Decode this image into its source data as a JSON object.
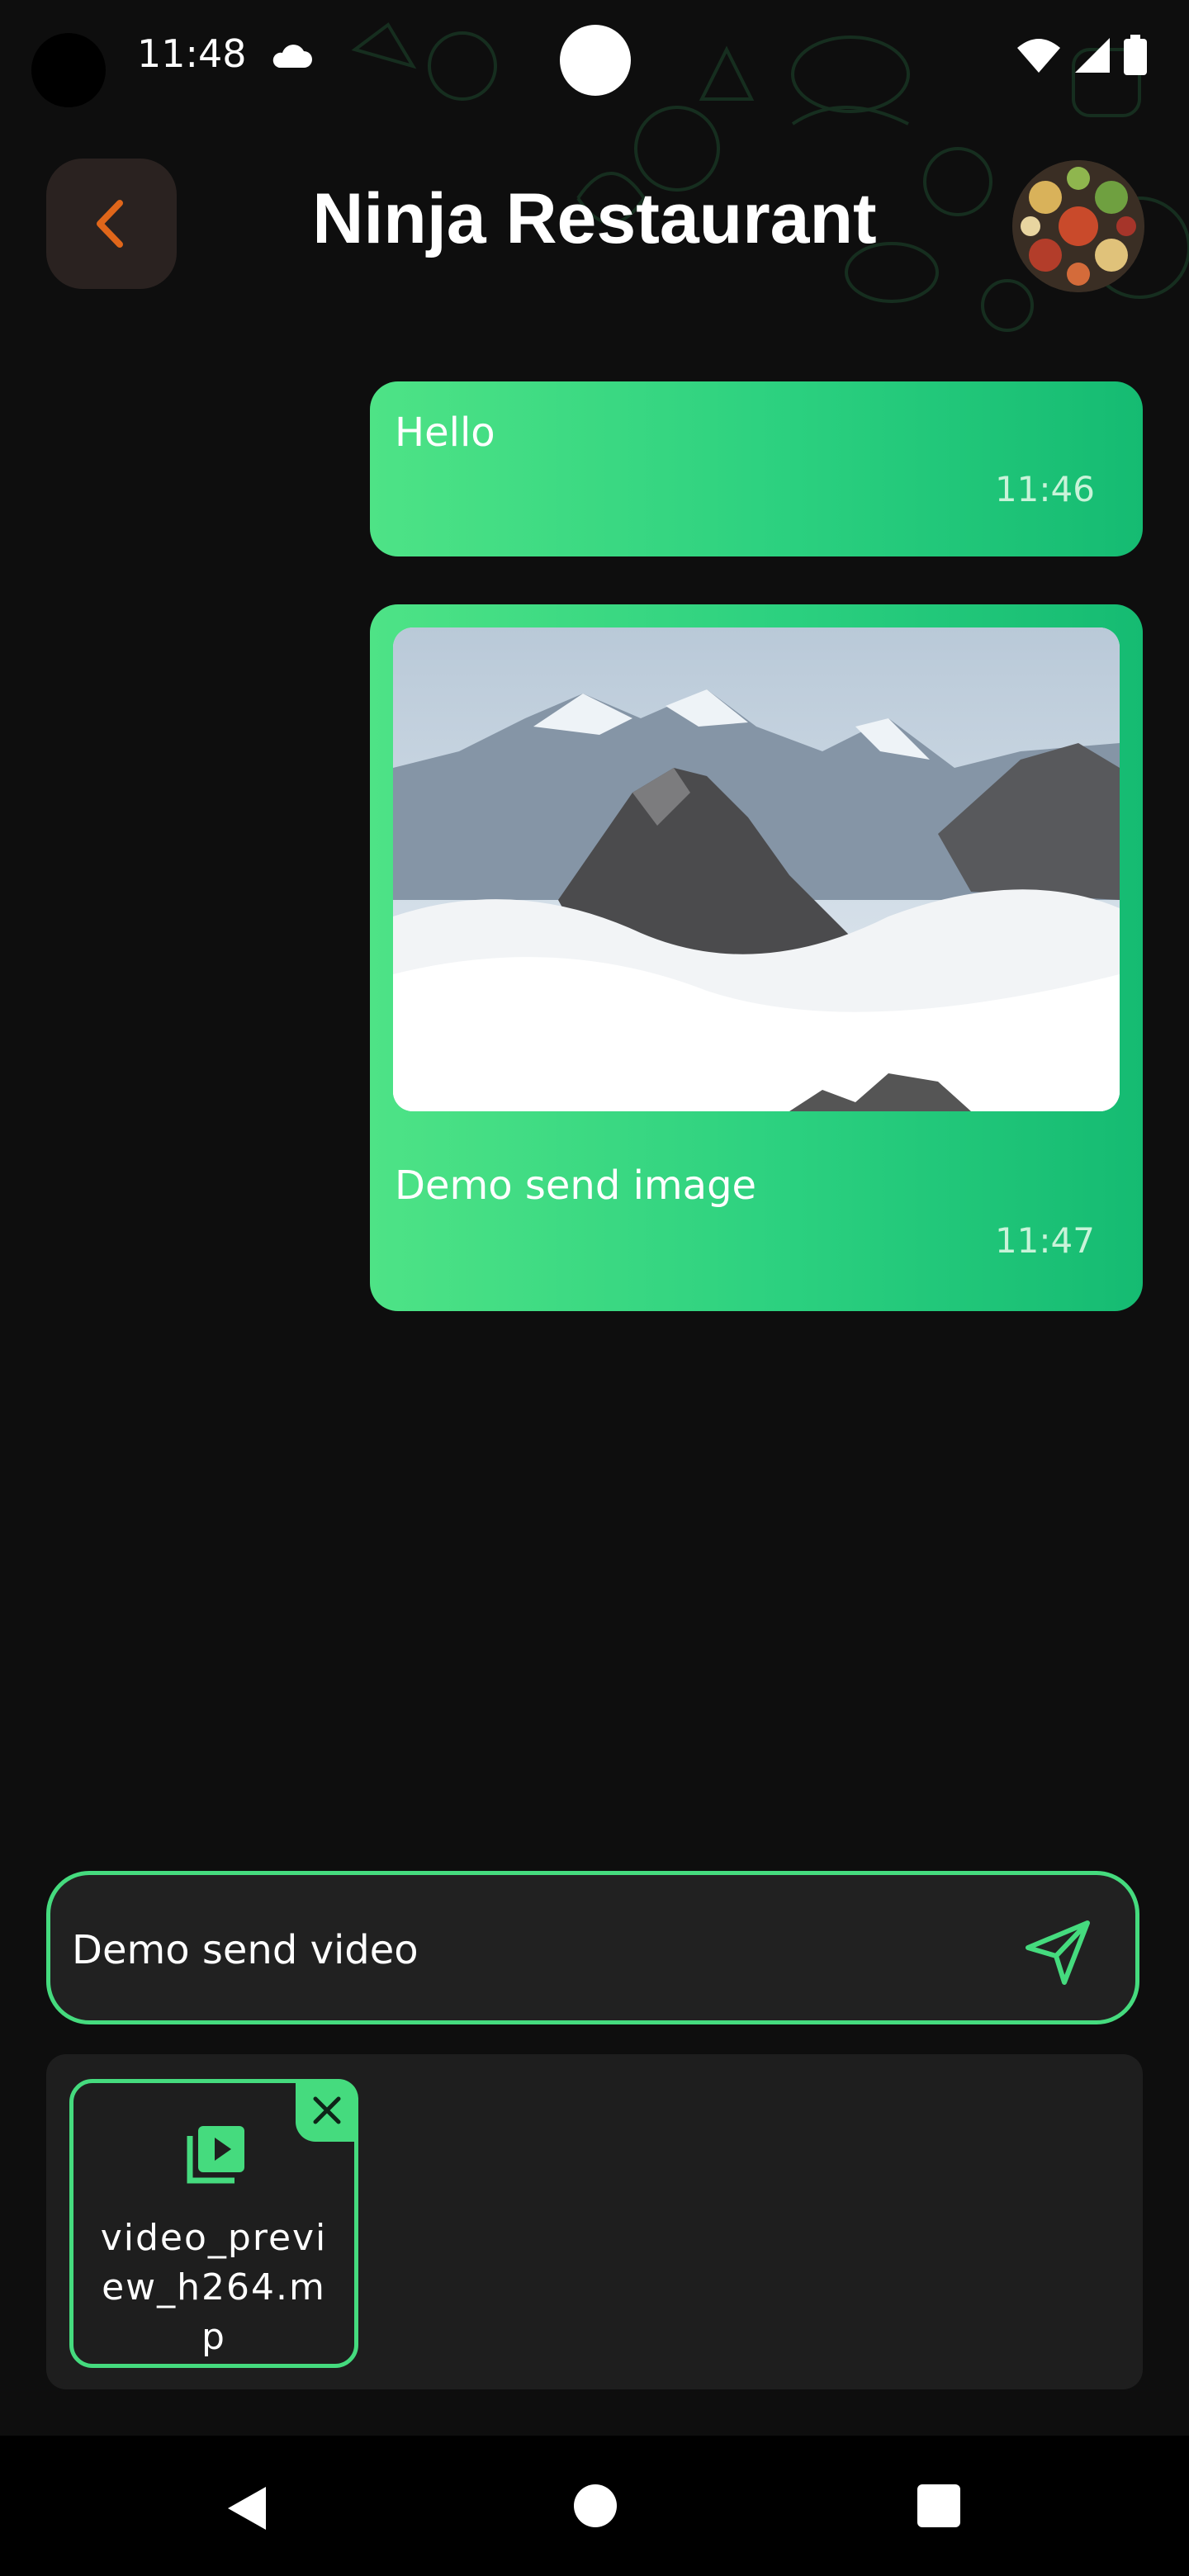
{
  "status_bar": {
    "time": "11:48"
  },
  "header": {
    "title": "Ninja Restaurant"
  },
  "messages": [
    {
      "text": "Hello",
      "time": "11:46",
      "has_image": false
    },
    {
      "text": "Demo send image",
      "time": "11:47",
      "has_image": true
    }
  ],
  "composer": {
    "value": "Demo send video",
    "placeholder": ""
  },
  "attachment": {
    "filename": "video_preview_h264.mp"
  },
  "colors": {
    "accent": "#45db7e",
    "background": "#0e0e0e",
    "back_icon": "#e0661a",
    "bubble_start": "#4ee386",
    "bubble_end": "#15bb72"
  },
  "icons": [
    "back-chevron-icon",
    "send-icon",
    "video-library-icon",
    "close-icon",
    "cloud-icon",
    "wifi-icon",
    "signal-icon",
    "battery-icon"
  ]
}
